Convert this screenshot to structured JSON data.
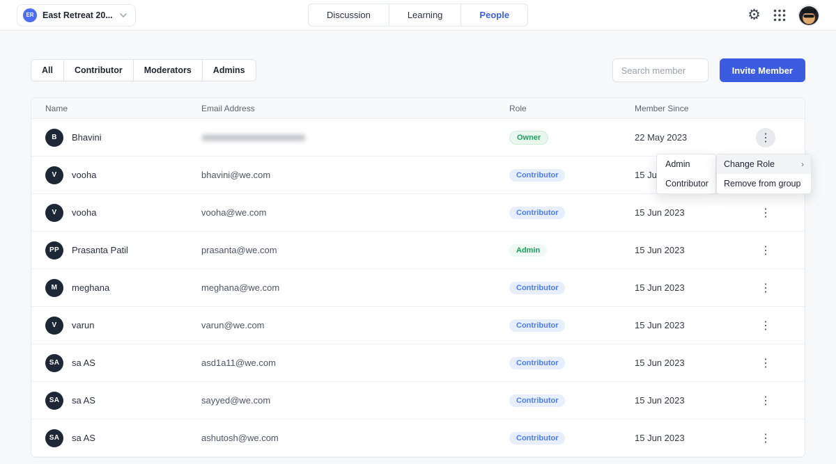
{
  "header": {
    "group": {
      "initials": "ER",
      "name": "East Retreat 20..."
    },
    "tabs": [
      {
        "label": "Discussion",
        "active": false
      },
      {
        "label": "Learning",
        "active": false
      },
      {
        "label": "People",
        "active": true
      }
    ]
  },
  "icons": {
    "gear": "⚙",
    "kebab": "⋮",
    "submenu_arrow": "›"
  },
  "filters": [
    "All",
    "Contributor",
    "Moderators",
    "Admins"
  ],
  "search": {
    "placeholder": "Search member"
  },
  "invite_button_label": "Invite Member",
  "table": {
    "columns": [
      "Name",
      "Email Address",
      "Role",
      "Member Since"
    ],
    "rows": [
      {
        "initials": "B",
        "name": "Bhavini",
        "email": "",
        "email_redacted": true,
        "role": "Owner",
        "role_type": "owner",
        "member_since": "22 May 2023",
        "menu_open": true
      },
      {
        "initials": "V",
        "name": "vooha",
        "email": "bhavini@we.com",
        "role": "Contributor",
        "role_type": "contributor",
        "member_since": "15 Jun 2023"
      },
      {
        "initials": "V",
        "name": "vooha",
        "email": "vooha@we.com",
        "role": "Contributor",
        "role_type": "contributor",
        "member_since": "15 Jun 2023"
      },
      {
        "initials": "PP",
        "name": "Prasanta Patil",
        "email": "prasanta@we.com",
        "role": "Admin",
        "role_type": "admin",
        "member_since": "15 Jun 2023"
      },
      {
        "initials": "M",
        "name": "meghana",
        "email": "meghana@we.com",
        "role": "Contributor",
        "role_type": "contributor",
        "member_since": "15 Jun 2023"
      },
      {
        "initials": "V",
        "name": "varun",
        "email": "varun@we.com",
        "role": "Contributor",
        "role_type": "contributor",
        "member_since": "15 Jun 2023"
      },
      {
        "initials": "SA",
        "name": "sa AS",
        "email": "asd1a11@we.com",
        "role": "Contributor",
        "role_type": "contributor",
        "member_since": "15 Jun 2023"
      },
      {
        "initials": "SA",
        "name": "sa AS",
        "email": "sayyed@we.com",
        "role": "Contributor",
        "role_type": "contributor",
        "member_since": "15 Jun 2023"
      },
      {
        "initials": "SA",
        "name": "sa AS",
        "email": "ashutosh@we.com",
        "role": "Contributor",
        "role_type": "contributor",
        "member_since": "15 Jun 2023"
      }
    ]
  },
  "context_menu": {
    "items": [
      {
        "label": "Change Role",
        "has_submenu": true,
        "highlighted": true
      },
      {
        "label": "Remove from group",
        "has_submenu": false,
        "highlighted": false
      }
    ],
    "role_submenu": [
      "Admin",
      "Contributor"
    ]
  }
}
